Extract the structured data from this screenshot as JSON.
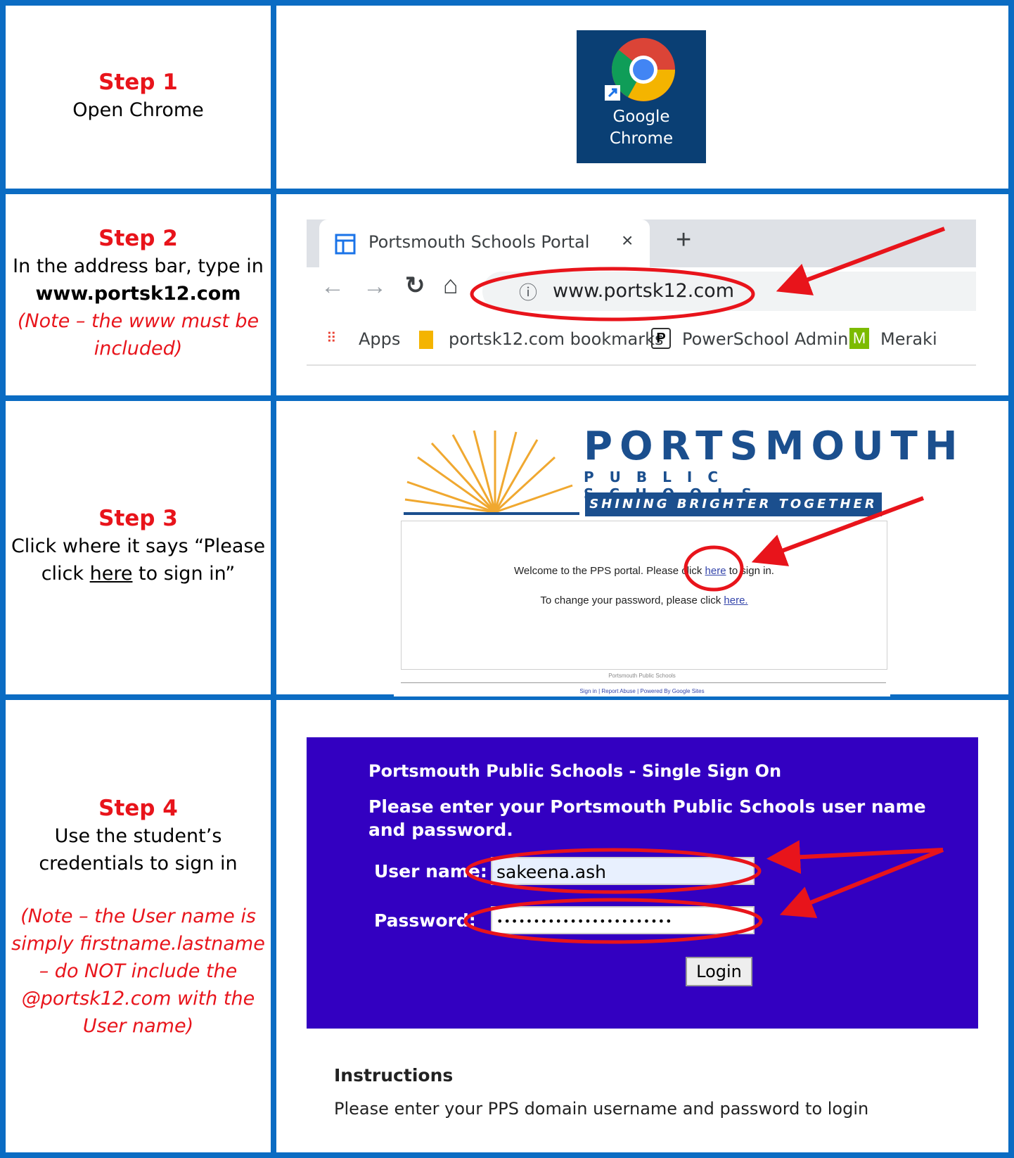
{
  "steps": [
    {
      "title": "Step 1",
      "lines": [
        "Open Chrome"
      ]
    },
    {
      "title": "Step 2",
      "line1": "In the address bar, type in",
      "bold": "www.portsk12.com",
      "note": "(Note – the www must be included)"
    },
    {
      "title": "Step 3",
      "line1": "Click where it says “Please",
      "line2_pre": "click ",
      "line2_u": "here",
      "line2_post": " to sign in”"
    },
    {
      "title": "Step 4",
      "line1": "Use the student’s",
      "line2": "credentials to sign in",
      "note": "(Note – the User name is simply firstname.lastname – do NOT include the @portsk12.com with the User name)"
    }
  ],
  "chrome_icon": {
    "label_line1": "Google",
    "label_line2": "Chrome"
  },
  "browser": {
    "tab_title": "Portsmouth Schools Portal",
    "close": "×",
    "new_tab": "+",
    "url": "www.portsk12.com",
    "bookmarks": [
      "Apps",
      "portsk12.com bookmarks",
      "PowerSchool Admin",
      "Meraki"
    ]
  },
  "portal": {
    "title": "PORTSMOUTH",
    "subtitle": "PUBLIC SCHOOLS",
    "tagline": "SHINING BRIGHTER TOGETHER",
    "welcome_pre": "Welcome to the PPS portal.  Please click ",
    "welcome_link": "here",
    "welcome_post": " to sign in.",
    "change_pre": "To change your password, please click ",
    "change_link": "here.",
    "footer_name": "Portsmouth Public Schools",
    "footer_links": "Sign in | Report Abuse | Powered By Google Sites"
  },
  "sso": {
    "title": "Portsmouth Public Schools - Single Sign On",
    "message": "Please enter your Portsmouth Public Schools user name and password.",
    "user_label": "User name:",
    "user_value": "sakeena.ash",
    "pass_label": "Password:",
    "pass_value": "••••••••••••••••••••••••",
    "login": "Login",
    "instructions_title": "Instructions",
    "instructions_text": "Please enter your PPS domain username and password to login"
  },
  "colors": {
    "border": "#0b6cc3",
    "step_red": "#e8141b",
    "sso_bg": "#3300c1",
    "pps_blue": "#1b4f8e"
  }
}
